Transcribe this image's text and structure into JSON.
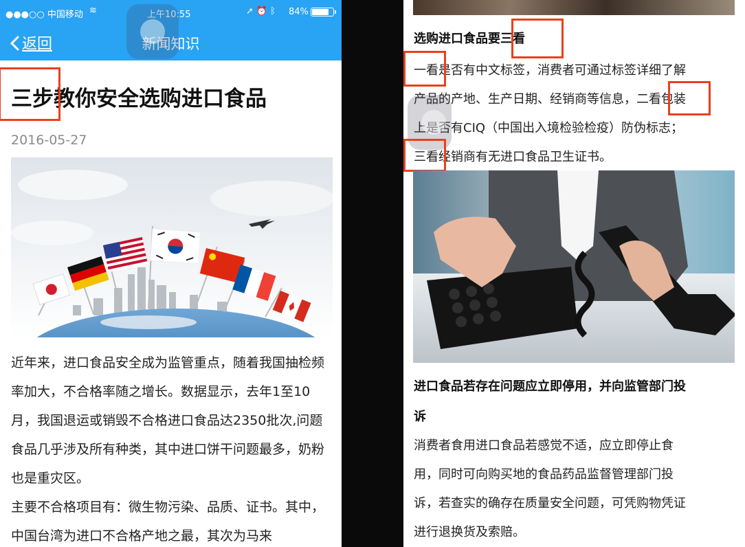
{
  "status_bar": {
    "carrier": "●●●○○ 中国移动",
    "time": "上午10:55",
    "battery_percent": "84%",
    "battery_level": 0.84
  },
  "nav": {
    "back_label": "返回",
    "title": "新闻知识"
  },
  "article": {
    "title": "三步教你安全选购进口食品",
    "date": "2016-05-27",
    "paragraphs": [
      "近年来，进口食品安全成为监管重点，随着我国抽检频率加大，不合格率随之增长。数据显示，去年1至10月，我国退运或销毁不合格进口食品达2350批次,问题食品几乎涉及所有种类，其中进口饼干问题最多，奶粉也是重灾区。",
      "主要不合格项目有：微生物污染、品质、证书。其中，中国台湾为进口不合格产地之最，其次为马来"
    ]
  },
  "right": {
    "heading": "选购进口食品要三看",
    "lines_top": [
      "一看是否有中文标签，消费者可通过标签详细了解",
      "产品的产地、生产日期、经销商等信息，二看包装",
      "上是否有CIQ（中国出入境检验检疫）防伪标志；",
      "三看经销商有无进口食品卫生证书。"
    ],
    "heading2_lines": [
      "进口食品若存在问题应立即停用，并向监管部门投",
      "诉"
    ],
    "lines_bottom": [
      "消费者食用进口食品若感觉不适，应立即停止食",
      "用，同时可向购买地的食品药品监督管理部门投",
      "诉，若查实的确存在质量安全问题，可凭购物凭证",
      "进行退换货及索赔。"
    ]
  },
  "colors": {
    "nav_blue": "#29a3f4",
    "highlight_red": "#e8411b"
  },
  "icons": [
    "wifi-icon",
    "location-icon",
    "alarm-icon",
    "bluetooth-icon",
    "battery-icon",
    "back-chevron-icon"
  ]
}
